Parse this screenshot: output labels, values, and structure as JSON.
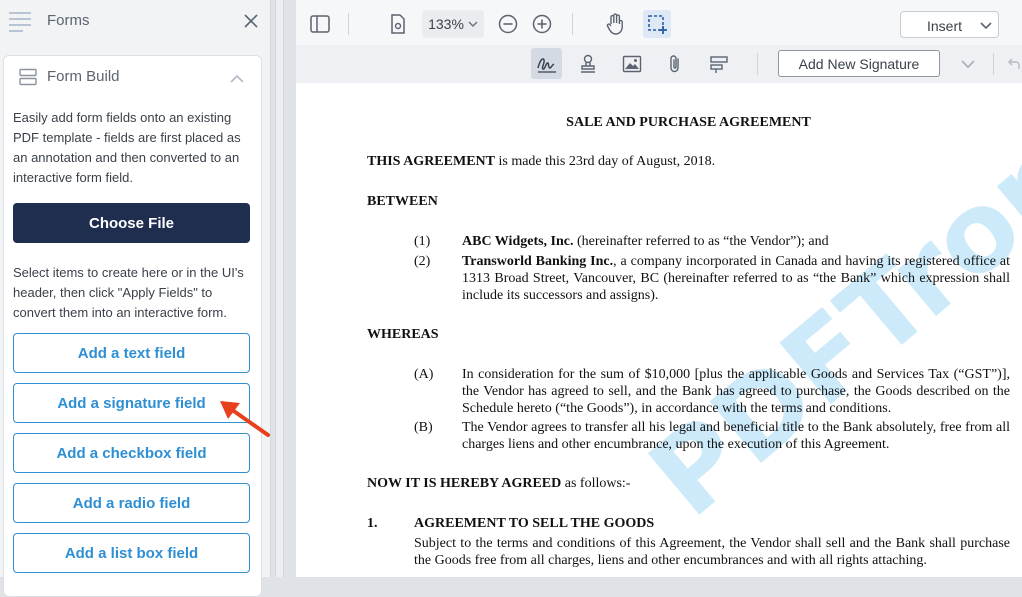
{
  "sidebar": {
    "title": "Forms",
    "panel_title": "Form Build",
    "description": "Easily add form fields onto an existing PDF template - fields are first placed as an annotation and then converted to an interactive form field.",
    "choose_file_label": "Choose File",
    "instructions": "Select items to create here or in the UI's header, then click \"Apply Fields\" to convert them into an interactive form.",
    "buttons": [
      {
        "label": "Add a text field"
      },
      {
        "label": "Add a signature field"
      },
      {
        "label": "Add a checkbox field"
      },
      {
        "label": "Add a radio field"
      },
      {
        "label": "Add a list box field"
      }
    ]
  },
  "toolbar": {
    "zoom": "133%",
    "insert_label": "Insert",
    "add_signature_label": "Add New Signature"
  },
  "document": {
    "title": "SALE AND PURCHASE AGREEMENT",
    "intro_bold": "THIS AGREEMENT",
    "intro_rest": " is made this 23rd day of August, 2018.",
    "between": "BETWEEN",
    "party1_num": "(1)",
    "party1_name": "ABC Widgets, Inc.",
    "party1_rest": " (hereinafter referred to as “the Vendor”); and",
    "party2_num": "(2)",
    "party2_name": "Transworld Banking Inc.",
    "party2_rest": ", a company incorporated in Canada and having its registered office at 1313 Broad Street, Vancouver, BC (hereinafter referred to as “the Bank” which expression shall include its successors and assigns).",
    "whereas": "WHEREAS",
    "recital_a_num": "(A)",
    "recital_a": "In consideration for the sum of $10,000 [plus the applicable Goods and Services Tax (“GST”)], the Vendor has agreed to sell, and the Bank has agreed to purchase, the Goods described on the Schedule hereto (“the Goods”), in accordance with the terms and conditions.",
    "recital_b_num": "(B)",
    "recital_b": "The Vendor agrees to transfer all his legal and beneficial title to the Bank absolutely, free from all charges liens and other encumbrance, upon the execution of this Agreement.",
    "agreed_bold": "NOW IT IS HEREBY AGREED",
    "agreed_rest": " as follows:-",
    "s1_num": "1.",
    "s1_title": "AGREEMENT TO SELL THE GOODS",
    "s1_text": "Subject to the terms and conditions of this Agreement, the Vendor shall sell and the Bank shall purchase the Goods free from all charges, liens and other encumbrances and with all rights attaching.",
    "watermark": "PDFTron"
  },
  "colors": {
    "accent": "#2f8fd3",
    "primary_button": "#1f2d4f",
    "arrow": "#e8401c"
  }
}
